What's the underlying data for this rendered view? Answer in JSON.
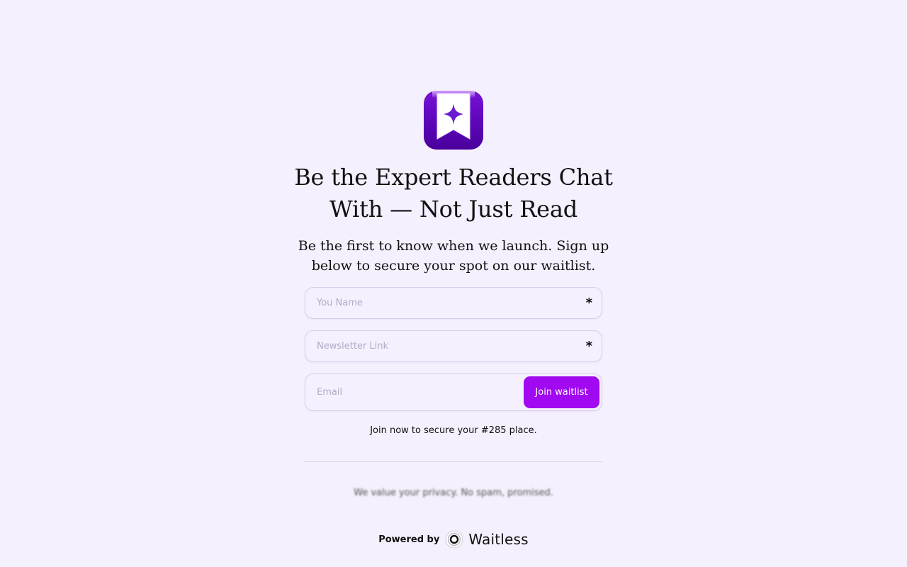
{
  "hero": {
    "headline": "Be the Expert Readers Chat With — Not Just Read",
    "subheadline": "Be the first to know when we launch. Sign up below to secure your spot on our waitlist."
  },
  "form": {
    "name_placeholder": "You Name",
    "newsletter_placeholder": "Newsletter Link",
    "email_placeholder": "Email",
    "required_mark": "*",
    "submit_label": "Join waitlist"
  },
  "waitlist_note": "Join now to secure your #285 place.",
  "privacy_note": "We value your privacy. No spam, promised.",
  "footer": {
    "powered_by": "Powered by",
    "brand": "Waitless"
  },
  "colors": {
    "background": "#f5f0fd",
    "accent": "#a10af0",
    "logo": "#5b06b8"
  }
}
